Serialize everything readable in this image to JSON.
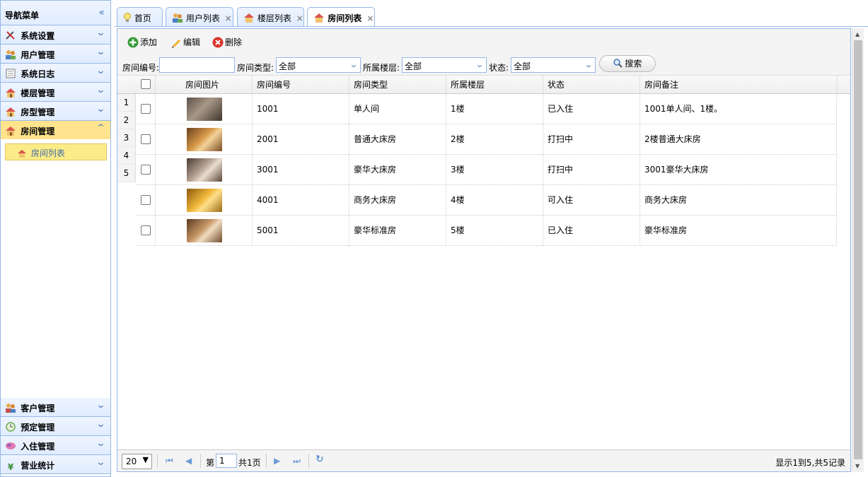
{
  "nav": {
    "title": "导航菜单",
    "items": [
      {
        "label": "系统设置",
        "icon": "tools-icon"
      },
      {
        "label": "用户管理",
        "icon": "users-icon"
      },
      {
        "label": "系统日志",
        "icon": "log-icon"
      },
      {
        "label": "楼层管理",
        "icon": "house-icon"
      },
      {
        "label": "房型管理",
        "icon": "house-icon"
      },
      {
        "label": "房间管理",
        "icon": "house-icon"
      }
    ],
    "active_sub": "房间列表",
    "bottom_items": [
      {
        "label": "客户管理",
        "icon": "customers-icon"
      },
      {
        "label": "预定管理",
        "icon": "clock-icon"
      },
      {
        "label": "入住管理",
        "icon": "checkin-icon"
      },
      {
        "label": "营业统计",
        "icon": "yen-icon"
      }
    ]
  },
  "tabs": [
    {
      "label": "首页",
      "icon": "bulb-icon"
    },
    {
      "label": "用户列表",
      "icon": "users-icon"
    },
    {
      "label": "楼层列表",
      "icon": "house-icon"
    },
    {
      "label": "房间列表",
      "icon": "house-icon"
    }
  ],
  "toolbar": {
    "add": "添加",
    "edit": "编辑",
    "delete": "删除"
  },
  "filters": {
    "room_no_label": "房间编号:",
    "room_no_value": "",
    "room_type_label": "房间类型:",
    "room_type_value": "全部",
    "floor_label": "所属楼层:",
    "floor_value": "全部",
    "status_label": "状态:",
    "status_value": "全部",
    "search": "搜索"
  },
  "grid": {
    "columns": [
      "房间图片",
      "房间编号",
      "房间类型",
      "所属楼层",
      "状态",
      "房间备注"
    ],
    "row_numbers": [
      "1",
      "2",
      "3",
      "4",
      "5"
    ],
    "rows": [
      {
        "no": "1001",
        "type": "单人间",
        "floor": "1楼",
        "status": "已入住",
        "note": "1001单人间、1楼。"
      },
      {
        "no": "2001",
        "type": "普通大床房",
        "floor": "2楼",
        "status": "打扫中",
        "note": "2楼普通大床房"
      },
      {
        "no": "3001",
        "type": "豪华大床房",
        "floor": "3楼",
        "status": "打扫中",
        "note": "3001豪华大床房"
      },
      {
        "no": "4001",
        "type": "商务大床房",
        "floor": "4楼",
        "status": "可入住",
        "note": "商务大床房"
      },
      {
        "no": "5001",
        "type": "豪华标准房",
        "floor": "5楼",
        "status": "已入住",
        "note": "豪华标准房"
      }
    ]
  },
  "pager": {
    "page_size": "20",
    "page_prefix": "第",
    "page_value": "1",
    "page_total": "共1页",
    "info": "显示1到5,共5记录"
  }
}
